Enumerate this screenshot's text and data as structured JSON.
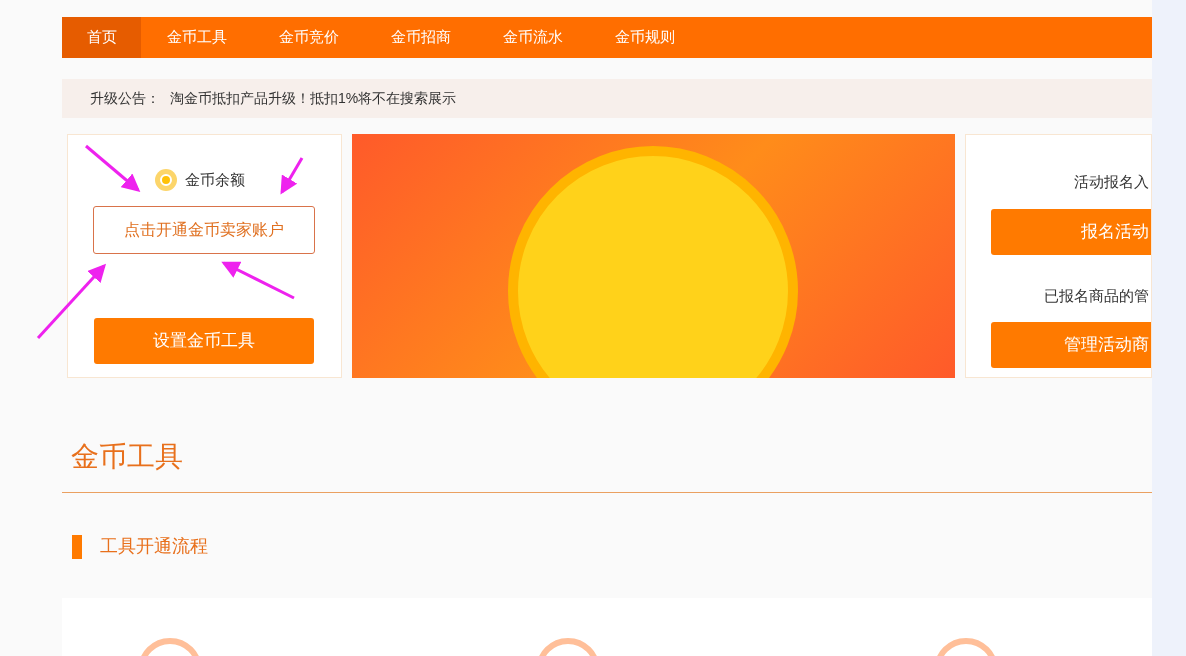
{
  "nav": [
    {
      "label": "首页",
      "selected": true
    },
    {
      "label": "金币工具",
      "selected": false
    },
    {
      "label": "金币竞价",
      "selected": false
    },
    {
      "label": "金币招商",
      "selected": false
    },
    {
      "label": "金币流水",
      "selected": false
    },
    {
      "label": "金币规则",
      "selected": false
    }
  ],
  "notice": {
    "label": "升级公告：",
    "text": "淘金币抵扣产品升级！抵扣1%将不在搜索展示"
  },
  "balance_card": {
    "label": "金币余额",
    "open_button": "点击开通金币卖家账户",
    "setup_button": "设置金币工具"
  },
  "activity_card": {
    "entry_label": "活动报名入",
    "signup_button": "报名活动",
    "manage_label": "已报名商品的管",
    "manage_button": "管理活动商"
  },
  "section_title": "金币工具",
  "subsection_title": "工具开通流程",
  "steps": [
    {
      "kind": "circle"
    },
    {
      "kind": "circle"
    },
    {
      "kind": "circle"
    }
  ]
}
